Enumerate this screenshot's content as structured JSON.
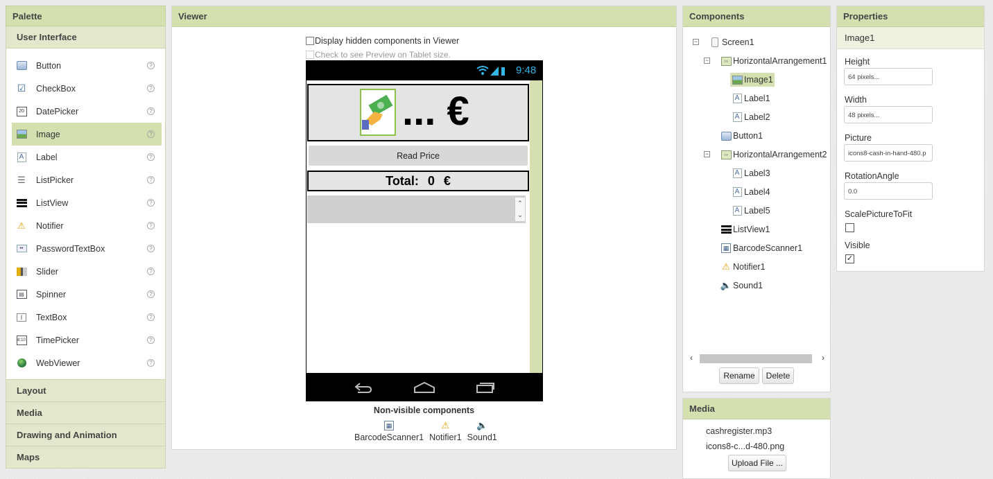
{
  "palette": {
    "title": "Palette",
    "active_category": "User Interface",
    "items": [
      {
        "label": "Button",
        "icon": "button-icon"
      },
      {
        "label": "CheckBox",
        "icon": "checkbox-icon"
      },
      {
        "label": "DatePicker",
        "icon": "datepicker-icon"
      },
      {
        "label": "Image",
        "icon": "image-icon",
        "selected": true
      },
      {
        "label": "Label",
        "icon": "label-icon"
      },
      {
        "label": "ListPicker",
        "icon": "listpicker-icon"
      },
      {
        "label": "ListView",
        "icon": "listview-icon"
      },
      {
        "label": "Notifier",
        "icon": "notifier-icon"
      },
      {
        "label": "PasswordTextBox",
        "icon": "password-icon"
      },
      {
        "label": "Slider",
        "icon": "slider-icon"
      },
      {
        "label": "Spinner",
        "icon": "spinner-icon"
      },
      {
        "label": "TextBox",
        "icon": "textbox-icon"
      },
      {
        "label": "TimePicker",
        "icon": "timepicker-icon"
      },
      {
        "label": "WebViewer",
        "icon": "webviewer-icon"
      }
    ],
    "help_glyph": "?",
    "categories": [
      "Layout",
      "Media",
      "Drawing and Animation",
      "Maps"
    ]
  },
  "viewer": {
    "title": "Viewer",
    "display_hidden_label": "Display hidden components in Viewer",
    "tablet_preview_label": "Check to see Preview on Tablet size.",
    "phone": {
      "time": "9:48",
      "amount_text": "... €",
      "read_price_button": "Read Price",
      "total_label": "Total:",
      "total_value": "0",
      "total_currency": "€"
    },
    "nonvisible_title": "Non-visible components",
    "nonvisible": [
      {
        "label": "BarcodeScanner1",
        "icon": "barcode-scanner-icon"
      },
      {
        "label": "Notifier1",
        "icon": "notifier-icon"
      },
      {
        "label": "Sound1",
        "icon": "sound-icon"
      }
    ]
  },
  "components": {
    "title": "Components",
    "tree": [
      {
        "label": "Screen1",
        "icon": "screen-icon",
        "level": 0,
        "toggle": "⊟"
      },
      {
        "label": "HorizontalArrangement1",
        "icon": "horizontal-arrangement-icon",
        "level": 1,
        "toggle": "⊟"
      },
      {
        "label": "Image1",
        "icon": "image-icon",
        "level": 2,
        "selected": true
      },
      {
        "label": "Label1",
        "icon": "label-icon",
        "level": 2
      },
      {
        "label": "Label2",
        "icon": "label-icon",
        "level": 2
      },
      {
        "label": "Button1",
        "icon": "button-icon",
        "level": 1
      },
      {
        "label": "HorizontalArrangement2",
        "icon": "horizontal-arrangement-icon",
        "level": 1,
        "toggle": "⊟"
      },
      {
        "label": "Label3",
        "icon": "label-icon",
        "level": 2
      },
      {
        "label": "Label4",
        "icon": "label-icon",
        "level": 2
      },
      {
        "label": "Label5",
        "icon": "label-icon",
        "level": 2
      },
      {
        "label": "ListView1",
        "icon": "listview-icon",
        "level": 1
      },
      {
        "label": "BarcodeScanner1",
        "icon": "barcode-scanner-icon",
        "level": 1
      },
      {
        "label": "Notifier1",
        "icon": "notifier-icon",
        "level": 1
      },
      {
        "label": "Sound1",
        "icon": "sound-icon",
        "level": 1
      }
    ],
    "rename_button": "Rename",
    "delete_button": "Delete"
  },
  "media": {
    "title": "Media",
    "files": [
      "cashregister.mp3",
      "icons8-c...d-480.png"
    ],
    "upload_button": "Upload File ..."
  },
  "properties": {
    "title": "Properties",
    "component": "Image1",
    "height_label": "Height",
    "height_value": "64 pixels...",
    "width_label": "Width",
    "width_value": "48 pixels...",
    "picture_label": "Picture",
    "picture_value": "icons8-cash-in-hand-480.p",
    "rotation_label": "RotationAngle",
    "rotation_value": "0.0",
    "scale_label": "ScalePictureToFit",
    "scale_checked": false,
    "visible_label": "Visible",
    "visible_checked": true
  },
  "colors": {
    "header_green": "#d4e0b0",
    "selection_green": "#d4e0b0",
    "image_border_green": "#8bc34a"
  }
}
